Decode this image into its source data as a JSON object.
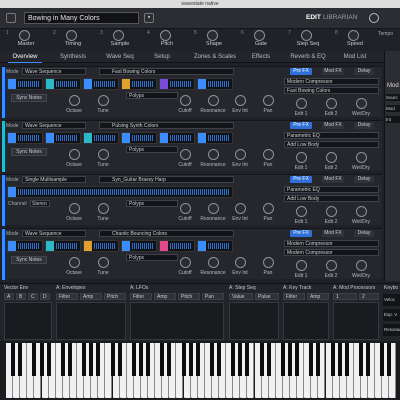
{
  "window": {
    "title": "wavestate native"
  },
  "header": {
    "performance_name": "Bowing in Many Colors",
    "edit_label": "EDIT",
    "librarian_label": "LIBRARIAN",
    "tempo_label": "Tempo"
  },
  "macros": [
    {
      "num": "1",
      "label": "Master"
    },
    {
      "num": "2",
      "label": "Timing"
    },
    {
      "num": "3",
      "label": "Sample"
    },
    {
      "num": "4",
      "label": "Pitch"
    },
    {
      "num": "5",
      "label": "Shape"
    },
    {
      "num": "6",
      "label": "Gate"
    },
    {
      "num": "7",
      "label": "Step Seq"
    },
    {
      "num": "8",
      "label": "Speed"
    }
  ],
  "tabs": [
    "Overview",
    "Synthesis",
    "Wave Seq",
    "Setup",
    "Zones & Scales",
    "Effects",
    "Reverb & EQ",
    "Mod List"
  ],
  "right_panel": {
    "title": "Mod",
    "items": [
      "Sourc",
      "Mod",
      "Int"
    ]
  },
  "parts": [
    {
      "letter": "A",
      "mode_label": "Mode",
      "mode": "Wave Sequence",
      "patch": "Fast Bowing Colors",
      "voicing": "Polyps",
      "lane_colors": [
        "#3a8cff",
        "#2cb8c8",
        "#3a8cff",
        "#e0a030",
        "#7a4ad8",
        "#3a8cff"
      ],
      "sync": "Sync Notes",
      "fx": {
        "pre": "Pre FX",
        "mod": "Mod FX",
        "delay": "Delay",
        "pre_sel": "Modern Compressor",
        "mod_sel": "Fast Bowing Colors"
      }
    },
    {
      "letter": "B",
      "mode_label": "Mode",
      "mode": "Wave Sequence",
      "patch": "Pulsing Synth Colors",
      "voicing": "Polyps",
      "lane_colors": [
        "#3a8cff",
        "#3a8cff",
        "#2cb8c8",
        "#3a8cff",
        "#3a8cff",
        "#3a8cff"
      ],
      "sync": "Sync Notes",
      "fx": {
        "pre": "Pre FX",
        "mod": "Mod FX",
        "delay": "Delay",
        "pre_sel": "Parametric EQ",
        "mod_sel": "Add Low Body"
      }
    },
    {
      "letter": "C",
      "mode_label": "Mode",
      "mode": "Single Multisample",
      "patch": "Syn_Guitar Brassy Harp",
      "voicing": "Polyps",
      "lane_colors": [
        "#3a8cff",
        "#3a8cff",
        "#3a8cff",
        "#3a8cff",
        "#3a8cff",
        "#3a8cff"
      ],
      "sync": "",
      "channel_label": "Channel",
      "channel": "Stereo",
      "fx": {
        "pre": "Pre FX",
        "mod": "Mod FX",
        "delay": "Delay",
        "pre_sel": "Parametric EQ",
        "mod_sel": "Add Low Body"
      }
    },
    {
      "letter": "D",
      "mode_label": "Mode",
      "mode": "Wave Sequence",
      "patch": "Chaotic Bouncing Colors",
      "voicing": "Polyps",
      "lane_colors": [
        "#3a8cff",
        "#2cb8c8",
        "#e0a030",
        "#3a8cff",
        "#e04a8a",
        "#3a8cff"
      ],
      "sync": "Sync Notes",
      "fx": {
        "pre": "Pre FX",
        "mod": "Mod FX",
        "delay": "Delay",
        "pre_sel": "Modern Compressor",
        "mod_sel": "Modern Compressor"
      }
    }
  ],
  "part_knobs": [
    "Octave",
    "Tune",
    "Cutoff",
    "Resonance",
    "Env Int",
    "Pan"
  ],
  "fx_knobs": [
    "Edit 1",
    "Edit 2",
    "Wet/Dry"
  ],
  "mod_panel": {
    "vector_env": {
      "title": "Vector Env",
      "cells": [
        "A",
        "B",
        "C",
        "D"
      ]
    },
    "envelopes": {
      "title": "A: Envelopes",
      "cells": [
        "Filter",
        "Amp",
        "Pitch"
      ]
    },
    "lfos": {
      "title": "A: LFOs",
      "cells": [
        "Filter",
        "Amp",
        "Pitch",
        "Pan"
      ]
    },
    "step_seq": {
      "title": "A: Step Seq",
      "cells": [
        "Value",
        "Pulse"
      ]
    },
    "key_track": {
      "title": "A: Key Track",
      "cells": [
        "Filter",
        "Amp"
      ]
    },
    "mod_processors": {
      "title": "A: Mod Processors",
      "cells": [
        "1",
        "2"
      ]
    },
    "keyboard": {
      "title": "Keybo",
      "items": [
        "Veloc",
        "Exp. V",
        "Resonan"
      ]
    }
  }
}
